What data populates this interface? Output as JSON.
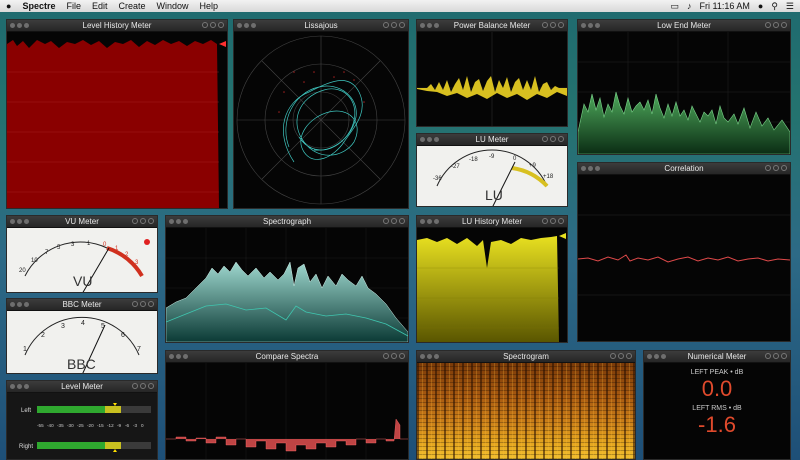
{
  "menubar": {
    "app": "Spectre",
    "items": [
      "File",
      "Edit",
      "Create",
      "Window",
      "Help"
    ],
    "clock": "Fri 11:16 AM"
  },
  "panels": {
    "level_history": "Level History Meter",
    "lissajous": "Lissajous",
    "power_balance": "Power Balance Meter",
    "low_end": "Low End Meter",
    "lu_meter": "LU Meter",
    "correlation": "Correlation",
    "vu_meter": "VU Meter",
    "spectrograph": "Spectrograph",
    "lu_history": "LU History Meter",
    "bbc_meter": "BBC Meter",
    "level_meter": "Level Meter",
    "compare_spectra": "Compare Spectra",
    "spectrogram": "Spectrogram",
    "numerical": "Numerical Meter"
  },
  "vu": {
    "label": "VU",
    "scale": [
      "20",
      "10",
      "7",
      "5",
      "3",
      "1",
      "0",
      "1",
      "2",
      "3"
    ]
  },
  "lu": {
    "label": "LU",
    "scale": [
      "-36",
      "-27",
      "-18",
      "-9",
      "0",
      "+9",
      "+18"
    ]
  },
  "bbc": {
    "label": "BBC",
    "scale": [
      "1",
      "2",
      "3",
      "4",
      "5",
      "6",
      "7"
    ]
  },
  "level_meter": {
    "left_label": "Left",
    "right_label": "Right",
    "scale": [
      "-55",
      "-40",
      "-35",
      "-30",
      "-25",
      "-20",
      "-15",
      "-12",
      "-9",
      "-6",
      "-3",
      "0"
    ]
  },
  "numerical": {
    "peak_label": "LEFT PEAK • dB",
    "peak_value": "0.0",
    "rms_label": "LEFT RMS • dB",
    "rms_value": "-1.6"
  },
  "colors": {
    "accent_red": "#e04a2c",
    "meter_yellow": "#d8d000",
    "lowend_green": "#4faa5c",
    "history_red": "#8a0000"
  }
}
